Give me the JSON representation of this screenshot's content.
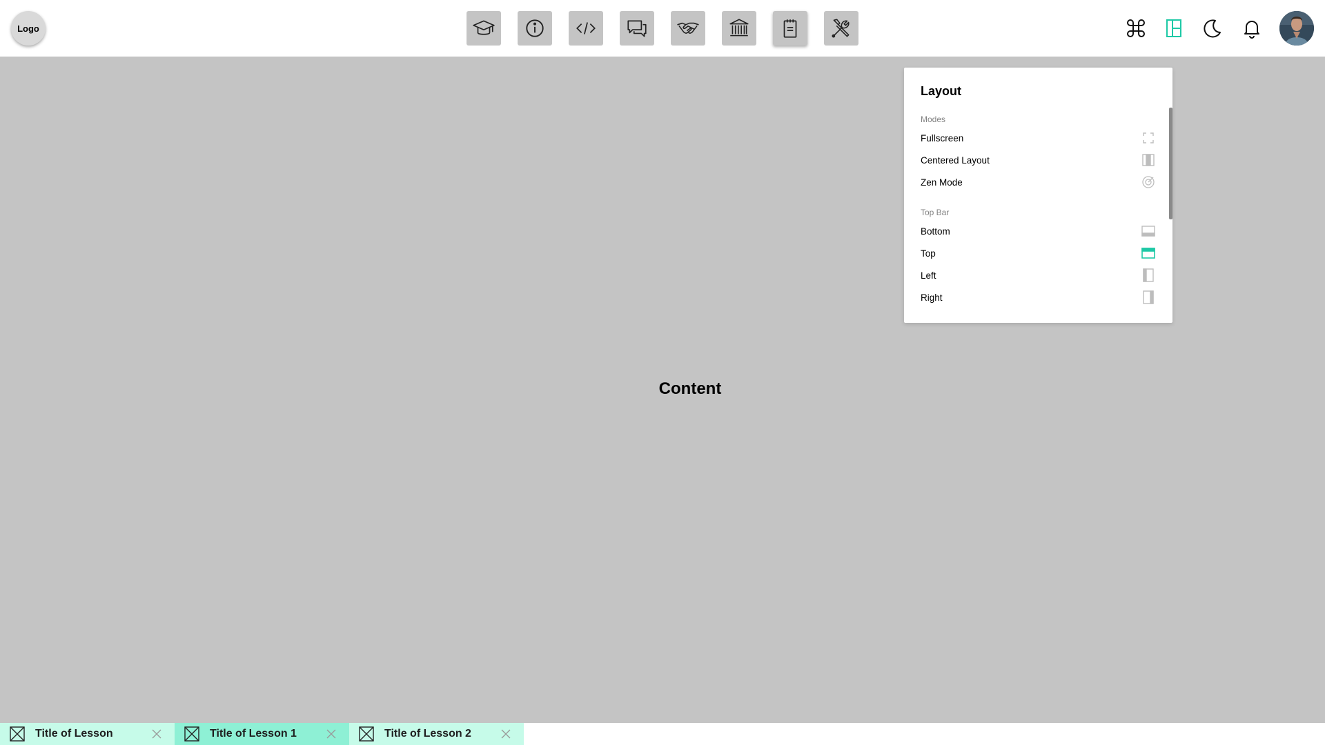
{
  "header": {
    "logo_label": "Logo",
    "nav_icons": [
      "graduation-cap-icon",
      "info-icon",
      "code-icon",
      "chat-icon",
      "handshake-icon",
      "library-icon",
      "clipboard-icon",
      "tools-icon"
    ],
    "right_icons": [
      "command-icon",
      "layout-icon",
      "moon-icon",
      "bell-icon",
      "avatar"
    ],
    "accent_color": "#1ec9a6"
  },
  "main": {
    "content_label": "Content"
  },
  "layout_panel": {
    "title": "Layout",
    "sections": [
      {
        "label": "Modes",
        "options": [
          {
            "label": "Fullscreen",
            "icon": "fullscreen-icon",
            "selected": false
          },
          {
            "label": "Centered Layout",
            "icon": "centered-layout-icon",
            "selected": false
          },
          {
            "label": "Zen Mode",
            "icon": "zen-mode-icon",
            "selected": false
          }
        ]
      },
      {
        "label": "Top Bar",
        "options": [
          {
            "label": "Bottom",
            "icon": "bar-bottom-icon",
            "selected": false
          },
          {
            "label": "Top",
            "icon": "bar-top-icon",
            "selected": true
          },
          {
            "label": "Left",
            "icon": "bar-left-icon",
            "selected": false
          },
          {
            "label": "Right",
            "icon": "bar-right-icon",
            "selected": false
          }
        ]
      }
    ]
  },
  "tabs": [
    {
      "title": "Title of Lesson",
      "bg": "#c6fbe9",
      "active": false
    },
    {
      "title": "Title of Lesson 1",
      "bg": "#8ef0d5",
      "active": true
    },
    {
      "title": "Title of Lesson 2",
      "bg": "#c6fbe9",
      "active": false
    }
  ]
}
